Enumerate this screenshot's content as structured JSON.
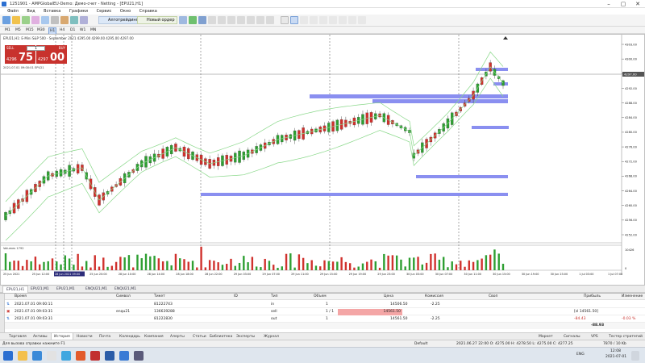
{
  "window": {
    "title": "1251901 - AMPGlobalEU-Demo: Демо-счет - Netting - [EPU21,H1]"
  },
  "menu": [
    "Файл",
    "Вид",
    "Вставка",
    "Графики",
    "Сервис",
    "Окно",
    "Справка"
  ],
  "toolbar": {
    "algo_label": "Алготрейдинг",
    "new_order_label": "Новый ордер"
  },
  "timeframes": [
    "M1",
    "M5",
    "M15",
    "M30",
    "H1",
    "H4",
    "D1",
    "W1",
    "MN"
  ],
  "active_timeframe": "H1",
  "chart": {
    "header": "EPU21,H1: E-Mini S&P 500 - September 2021   4295.00 4299.00 4295.00 4297.00",
    "trade_panel": {
      "sell_label": "SELL",
      "buy_label": "BUY",
      "lots": "1",
      "sell_small": "4296",
      "sell_big": "75",
      "buy_small": "4297",
      "buy_big": "00"
    },
    "subline": "2021.07.01 09:00:01 EPU21",
    "indicator_label": "Volumes 1792",
    "price_axis": [
      "4303.00",
      "4300.00",
      "4296.00",
      "4292.00",
      "4288.00",
      "4284.00",
      "4280.00",
      "4276.00",
      "4272.00",
      "4268.00",
      "4264.00",
      "4260.00",
      "4256.00",
      "4252.00"
    ],
    "current_price": "4297.00",
    "vol_axis": [
      "10426",
      "0"
    ],
    "time_axis": [
      "25 Jun 2021",
      "25 Jun 12:00",
      "25 Jun 16:00",
      "25 Jun 20:00",
      "28 Jun 10:00",
      "28 Jun 14:00",
      "28 Jun 18:00",
      "28 Jun 22:00",
      "29 Jun 03:00",
      "29 Jun 07:00",
      "29 Jun 11:00",
      "29 Jun 15:00",
      "29 Jun 19:00",
      "29 Jun 23:00",
      "30 Jun 03:00",
      "30 Jun 07:00",
      "30 Jun 11:00",
      "30 Jun 15:00",
      "30 Jun 19:00",
      "30 Jun 23:00",
      "1 Jul 03:00",
      "1 Jul 07:00"
    ],
    "highlight_time": "28 Jun 2021 09:00"
  },
  "chart_tabs": [
    "EPU21,H1",
    "EPU21,M1",
    "EPU21,M1",
    "ENQU21,M1",
    "ENQU21,M1"
  ],
  "history": {
    "columns": [
      "Время",
      "Символ",
      "Тикет",
      "ID",
      "Тип",
      "Объем",
      "Цена",
      "Комиссия",
      "Своп",
      "Прибыль",
      "Изменение"
    ],
    "rows": [
      {
        "time": "2021.07.01 09:00:11",
        "symbol": "",
        "ticket": "81222743",
        "id": "",
        "type": "in",
        "volume": "1",
        "price": "14506.50",
        "commission": "-2.25",
        "swap": "",
        "profit": "",
        "change": ""
      },
      {
        "time": "2021.07.01 09:03:31",
        "symbol": "enqu21",
        "ticket": "136639288",
        "id": "",
        "type": "sell",
        "volume": "1 / 1",
        "price": "14561.50",
        "commission": "",
        "swap": "",
        "profit": "[sl 14561.50]",
        "change": ""
      },
      {
        "time": "2021.07.01 09:03:31",
        "symbol": "",
        "ticket": "81222830",
        "id": "",
        "type": "out",
        "volume": "1",
        "price": "14561.50",
        "commission": "-2.25",
        "swap": "",
        "profit": "-84.43",
        "change": "-0.03 %"
      }
    ],
    "total": "-88.93"
  },
  "toolbox_side_label": "Инструменты",
  "bottom_tabs": [
    "Торговля",
    "Активы",
    "История",
    "Новости",
    "Почта",
    "Календарь",
    "Компания",
    "Алерты",
    "Статьи",
    "Библиотека",
    "Эксперты",
    "Журнал"
  ],
  "bottom_active": "История",
  "bottom_right": [
    "Маркет",
    "Сигналы",
    "VPS",
    "Тестер стратегий"
  ],
  "status": {
    "help": "Для вызова справки нажмите F1",
    "profile": "Default",
    "ohlc": "2021.06.27 22:00   O: 4275.00   H: 4278.50   L: 4275.00   C: 4277.25",
    "traffic": "7870 / 10 Kb"
  },
  "taskbar": {
    "lang": "ENG",
    "time": "12:08",
    "date": "2021-07-01"
  },
  "colors": {
    "bull": "#2e9f32",
    "bear": "#d0312d",
    "band": "#8ad88a",
    "zone": "#8a8ff0",
    "sell_panel": "#c8322d"
  }
}
